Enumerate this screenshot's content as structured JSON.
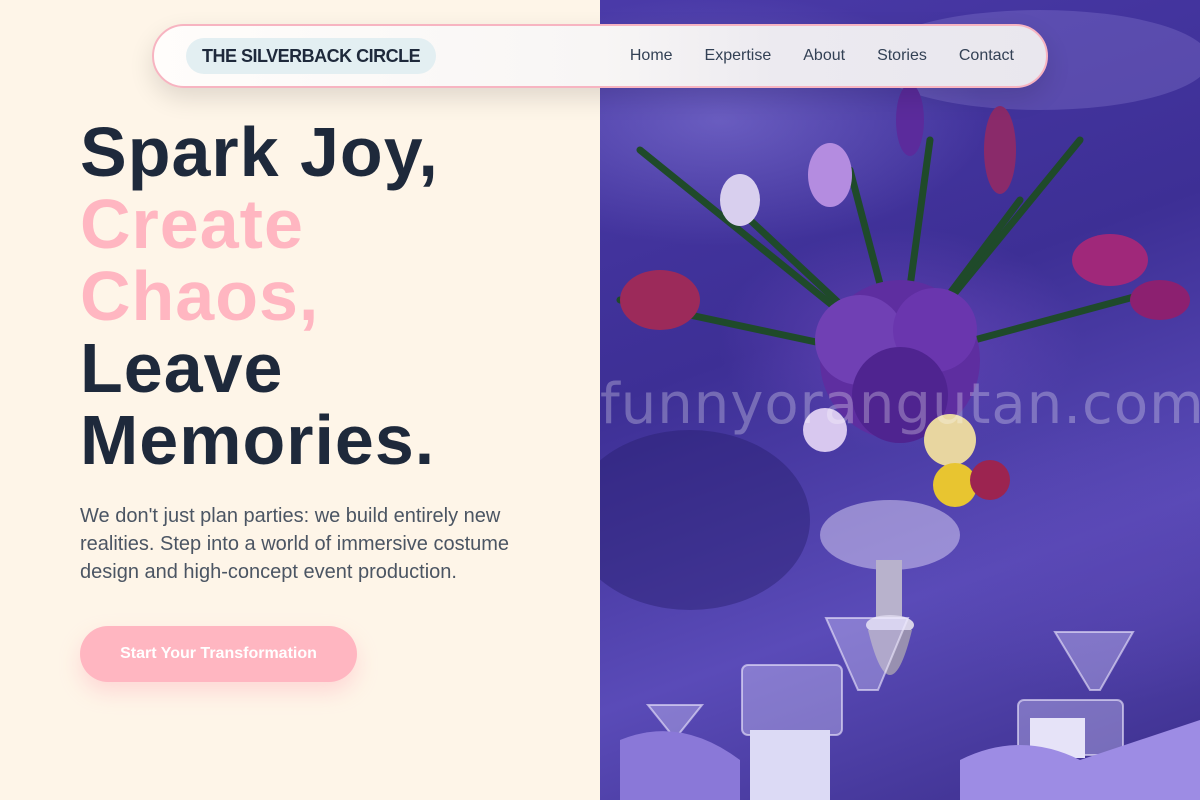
{
  "brand": {
    "name": "THE SILVERBACK CIRCLE"
  },
  "nav": {
    "links": [
      "Home",
      "Expertise",
      "About",
      "Stories",
      "Contact"
    ]
  },
  "hero": {
    "line1": "Spark Joy,",
    "line2": "Create",
    "line3": "Chaos,",
    "line4": "Leave",
    "line5": "Memories.",
    "description": "We don't just plan parties: we build entirely new realities. Step into a world of immersive costume design and high-concept event production.",
    "cta_label": "Start Your Transformation"
  },
  "image": {
    "watermark": "funnyorangutan.com"
  },
  "colors": {
    "accent_pink": "#ffb6c1",
    "text_dark": "#1e293b",
    "background_cream": "#fef5e8"
  }
}
